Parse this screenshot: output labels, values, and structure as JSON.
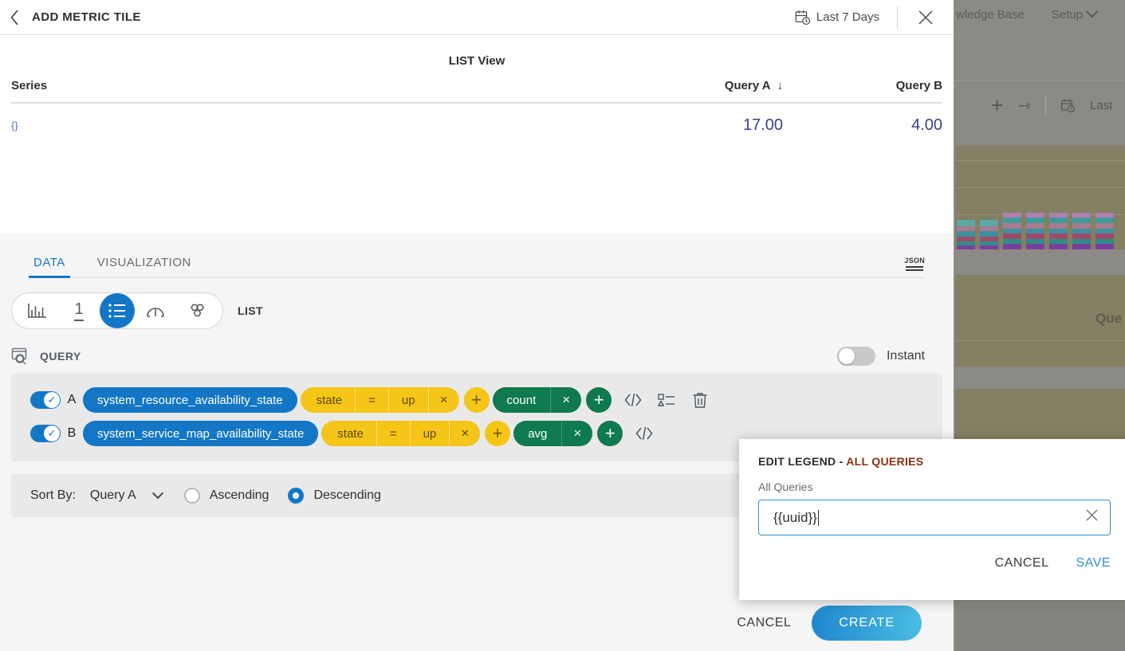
{
  "background": {
    "nav": [
      {
        "label": "wledge Base",
        "icon": ""
      },
      {
        "label": "Setup",
        "icon": "chevron-down-icon"
      }
    ],
    "toolbar": {
      "add_label": "+",
      "share_label": "⇾",
      "time_label": "Last"
    },
    "widget_title": "Que"
  },
  "header": {
    "back_icon": "chevron-left-icon",
    "title": "ADD METRIC TILE",
    "time_range": "Last 7 Days",
    "time_range_icon": "calendar-clock-icon",
    "close_icon": "close-icon"
  },
  "preview": {
    "title": "LIST View",
    "columns": [
      "Series",
      "Query A",
      "Query B"
    ],
    "sort_indicator": "↓",
    "rows": [
      {
        "series": "{}",
        "query_a": "17.00",
        "query_b": "4.00"
      }
    ]
  },
  "tabs": [
    {
      "label": "DATA",
      "active": true
    },
    {
      "label": "VISUALIZATION",
      "active": false
    }
  ],
  "json_button": {
    "label": "JSON"
  },
  "chart_types": [
    {
      "name": "bar-chart-icon",
      "selected": false
    },
    {
      "name": "single-value-icon",
      "label": "1",
      "selected": false
    },
    {
      "name": "list-icon",
      "selected": true
    },
    {
      "name": "gauge-icon",
      "selected": false
    },
    {
      "name": "honeycomb-icon",
      "selected": false
    }
  ],
  "chart_type_label": "LIST",
  "query_section": {
    "icon": "query-search-icon",
    "title": "QUERY",
    "instant_label": "Instant",
    "instant_enabled": false,
    "rows": [
      {
        "enabled": true,
        "letter": "A",
        "metric": "system_resource_availability_state",
        "filter": {
          "field": "state",
          "operator": "=",
          "value": "up",
          "remove": "×"
        },
        "add_filter": "+",
        "aggregate": {
          "label": "count",
          "remove": "×"
        },
        "add_aggregate": "+",
        "icons": [
          "code-icon",
          "legend-icon",
          "delete-icon"
        ]
      },
      {
        "enabled": true,
        "letter": "B",
        "metric": "system_service_map_availability_state",
        "filter": {
          "field": "state",
          "operator": "=",
          "value": "up",
          "remove": "×"
        },
        "add_filter": "+",
        "aggregate": {
          "label": "avg",
          "remove": "×"
        },
        "add_aggregate": "+",
        "icons": [
          "code-icon",
          "legend-icon",
          "delete-icon"
        ]
      }
    ]
  },
  "sort": {
    "label": "Sort By:",
    "selected": "Query A",
    "options": [
      "Ascending",
      "Descending"
    ],
    "ascending_label": "Ascending",
    "descending_label": "Descending",
    "direction": "Descending"
  },
  "footer": {
    "cancel_label": "CANCEL",
    "create_label": "CREATE"
  },
  "edit_legend_popup": {
    "title_prefix": "EDIT LEGEND - ",
    "title_accent": "ALL QUERIES",
    "field_label": "All Queries",
    "field_value": "{{uuid}}",
    "clear_icon": "close-icon",
    "cancel_label": "CANCEL",
    "save_label": "SAVE"
  },
  "colors": {
    "accent_blue": "#1477c6",
    "pill_yellow": "#f5c518",
    "pill_green": "#0f7a4f",
    "value_blue": "#3b3f8f",
    "accent_red": "#8c2f0d"
  }
}
